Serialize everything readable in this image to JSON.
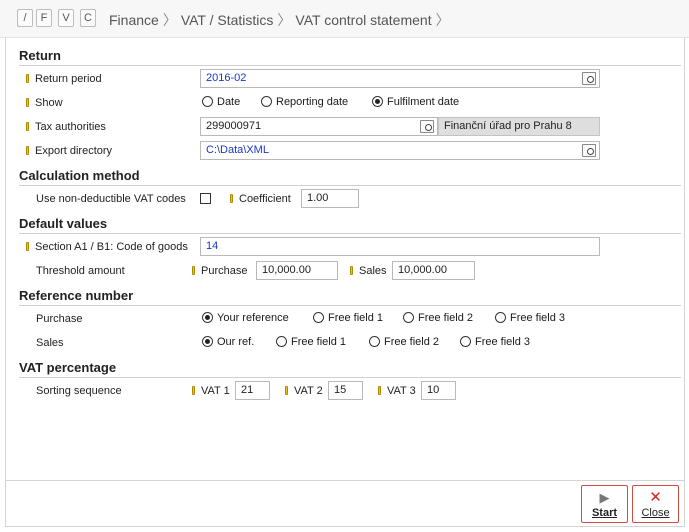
{
  "quick_buttons": [
    "/",
    "F",
    "V",
    "C"
  ],
  "breadcrumb": [
    "Finance",
    "VAT / Statistics",
    "VAT control statement"
  ],
  "sections": {
    "return": "Return",
    "calculation": "Calculation method",
    "defaults": "Default values",
    "reference": "Reference number",
    "vat_pct": "VAT percentage"
  },
  "return": {
    "period_label": "Return period",
    "period_value": "2016-02",
    "show_label": "Show",
    "show_options": [
      "Date",
      "Reporting date",
      "Fulfilment date"
    ],
    "show_selected": "Fulfilment date",
    "tax_label": "Tax authorities",
    "tax_value": "299000971",
    "tax_name": "Finanční úřad pro Prahu 8",
    "export_label": "Export directory",
    "export_value": "C:\\Data\\XML"
  },
  "calculation": {
    "nondeductible_label": "Use non-deductible VAT codes",
    "nondeductible_checked": false,
    "coefficient_label": "Coefficient",
    "coefficient_value": "1.00"
  },
  "defaults": {
    "code_label": "Section A1 / B1: Code of goods",
    "code_value": "14",
    "threshold_label": "Threshold amount",
    "purchase_label": "Purchase",
    "purchase_value": "10,000.00",
    "sales_label": "Sales",
    "sales_value": "10,000.00"
  },
  "reference": {
    "purchase_label": "Purchase",
    "purchase_options": [
      "Your reference",
      "Free field 1",
      "Free field 2",
      "Free field 3"
    ],
    "purchase_selected": "Your reference",
    "sales_label": "Sales",
    "sales_options": [
      "Our ref.",
      "Free field 1",
      "Free field 2",
      "Free field 3"
    ],
    "sales_selected": "Our ref."
  },
  "vat_pct": {
    "sorting_label": "Sorting sequence",
    "vat1_label": "VAT 1",
    "vat1_value": "21",
    "vat2_label": "VAT 2",
    "vat2_value": "15",
    "vat3_label": "VAT 3",
    "vat3_value": "10"
  },
  "footer": {
    "start_label": "Start",
    "close_label": "Close"
  },
  "colors": {
    "required_marker": "#e6c316",
    "field_value_blue": "#1c35c9",
    "action_border": "#d24b4b"
  }
}
